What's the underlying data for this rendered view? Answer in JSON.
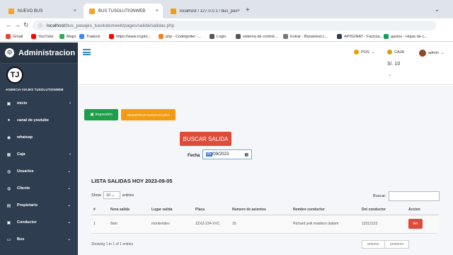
{
  "browser": {
    "tabs": [
      {
        "title": "NUEVO BUS",
        "color": "#f5a623",
        "active": false
      },
      {
        "title": "BUS TUSOLUTIONWEB",
        "color": "#f5a623",
        "active": true
      },
      {
        "title": "localhost / 127.0.0.1 / bus_pasaje",
        "color": "#f39c12",
        "active": false
      }
    ],
    "new_tab": "+",
    "url_host": "localhost",
    "url_path": "/bus_pasajes_tusolutionweb/pages/salida/salidas.php",
    "bookmarks": [
      {
        "label": "Gmail",
        "color": "#ea4335"
      },
      {
        "label": "YouTube",
        "color": "#ff0000"
      },
      {
        "label": "Maps",
        "color": "#34a853"
      },
      {
        "label": "Traducir",
        "color": "#4285f4"
      },
      {
        "label": "https://www.crypto...",
        "color": "#ff0000"
      },
      {
        "label": "php - Codeigniter -...",
        "color": "#f48024"
      },
      {
        "label": "Login",
        "color": "#555555"
      },
      {
        "label": "sistema de control...",
        "color": "#555555"
      },
      {
        "label": "Entrar - BanaHost.c...",
        "color": "#777777"
      },
      {
        "label": "APISUNAT - Factura...",
        "color": "#2c3e50"
      },
      {
        "label": "gastos - Hojas de c...",
        "color": "#0f9d58"
      }
    ]
  },
  "sidebar": {
    "title": "Administracion",
    "logo_letter": "TJ",
    "logo_caption": "AGENCIA VIAJES TUSOLUTIONWEB",
    "items": [
      {
        "label": "inicio",
        "icon": "▣",
        "has_arrow": true,
        "arrow": "›"
      },
      {
        "label": "canal de youtube",
        "icon": "●",
        "has_arrow": false,
        "arrow": ""
      },
      {
        "label": "whatsap",
        "icon": "◉",
        "has_arrow": false,
        "arrow": ""
      },
      {
        "label": "Caja",
        "icon": "▦",
        "has_arrow": true,
        "arrow": "›"
      },
      {
        "label": "Usuarios",
        "icon": "◍",
        "has_arrow": true,
        "arrow": "⌄"
      },
      {
        "label": "Cliente",
        "icon": "◍",
        "has_arrow": true,
        "arrow": "⌄"
      },
      {
        "label": "Propietario",
        "icon": "▤",
        "has_arrow": true,
        "arrow": "⌄"
      },
      {
        "label": "Conductor",
        "icon": "▣",
        "has_arrow": true,
        "arrow": "⌄"
      },
      {
        "label": "Bus",
        "icon": "▭",
        "has_arrow": true,
        "arrow": "⌄"
      }
    ]
  },
  "topbar": {
    "pos_label": "POS",
    "caja_label": "CAJA",
    "user_label": "admin",
    "balance": "S/. 10"
  },
  "actions": {
    "impresion": "Impresión",
    "registrar": "REGISTRAR NUEVA SALIDA",
    "buscar": "BUSCAR SALIDA",
    "fecha_label": "Fecha",
    "fecha_day": "05",
    "fecha_rest": "/09/2023"
  },
  "list": {
    "title": "LISTA SALIDAS HOY 2023-09-05",
    "show_label": "Show",
    "show_value": "10",
    "entries_label": "entries",
    "search_label": "Buscar:",
    "columns": [
      "#",
      "Nora salida",
      "Lugar salida",
      "Placa",
      "Numero de asientos",
      "Nombre conductor",
      "Dni conductor",
      "Accion"
    ],
    "rows": [
      {
        "num": "1",
        "hora": "8am",
        "lugar": "montevideo",
        "placa": "ZZXZ-234-XVC",
        "asientos": "15",
        "conductor": "Richard yeik madison dabom",
        "dni": "12312123",
        "accion": "Ver"
      }
    ],
    "info": "Showing 1 to 1 of 1 entries",
    "prev": "anterior",
    "next": "posterior"
  }
}
